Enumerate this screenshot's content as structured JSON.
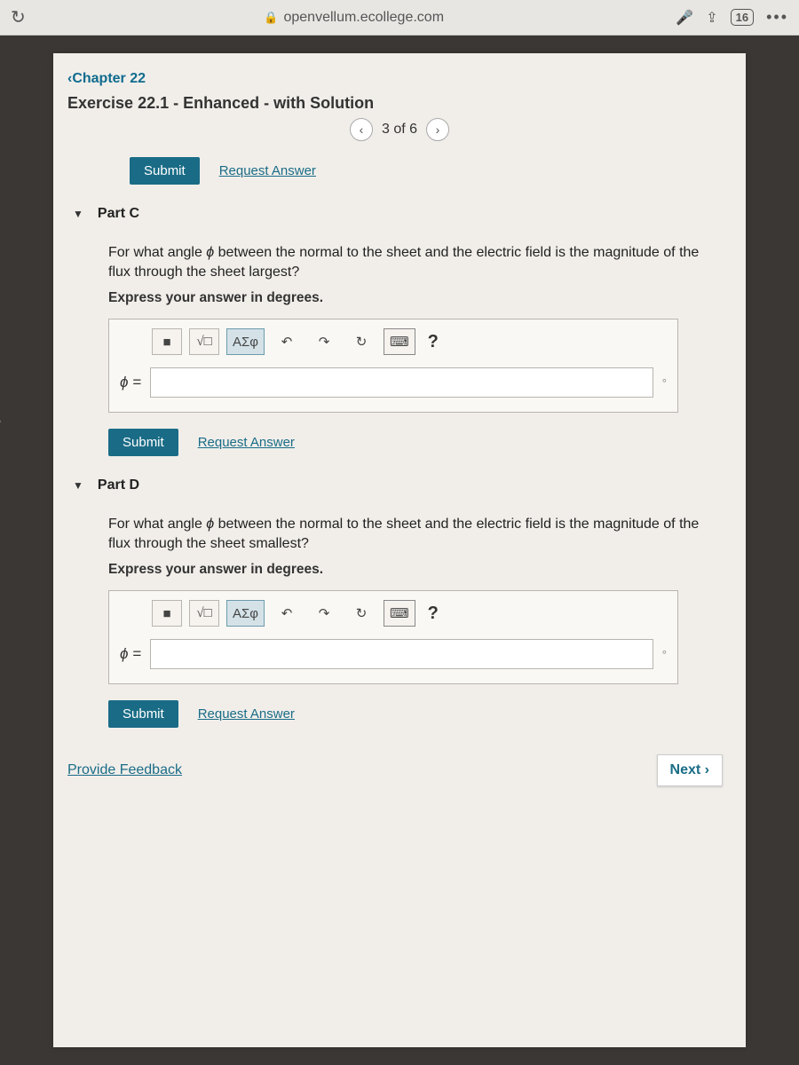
{
  "browser": {
    "url": "openvellum.ecollege.com",
    "tab_count": "16"
  },
  "breadcrumb": {
    "chapter_prefix": "‹",
    "chapter_label": "Chapter 22"
  },
  "exercise": {
    "title": "Exercise 22.1 - Enhanced - with Solution",
    "pager": "3 of 6"
  },
  "buttons": {
    "submit": "Submit",
    "request_answer": "Request Answer",
    "next": "Next ›",
    "provide_feedback": "Provide Feedback"
  },
  "toolbar": {
    "templates": "■",
    "sqrt": "√□",
    "greek": "ΑΣφ",
    "undo": "↶",
    "redo": "↷",
    "reset": "↻",
    "keyboard": "⌨",
    "help": "?"
  },
  "parts": [
    {
      "label": "Part C",
      "question_prefix": "For what angle ",
      "question_var": "ϕ",
      "question_suffix": " between the normal to the sheet and the electric field is the magnitude of the flux through the sheet largest?",
      "instruction": "Express your answer in degrees.",
      "var_label": "ϕ =",
      "unit_suffix": "°"
    },
    {
      "label": "Part D",
      "question_prefix": "For what angle ",
      "question_var": "ϕ",
      "question_suffix": " between the normal to the sheet and the electric field is the magnitude of the flux through the sheet smallest?",
      "instruction": "Express your answer in degrees.",
      "var_label": "ϕ =",
      "unit_suffix": "°"
    }
  ]
}
